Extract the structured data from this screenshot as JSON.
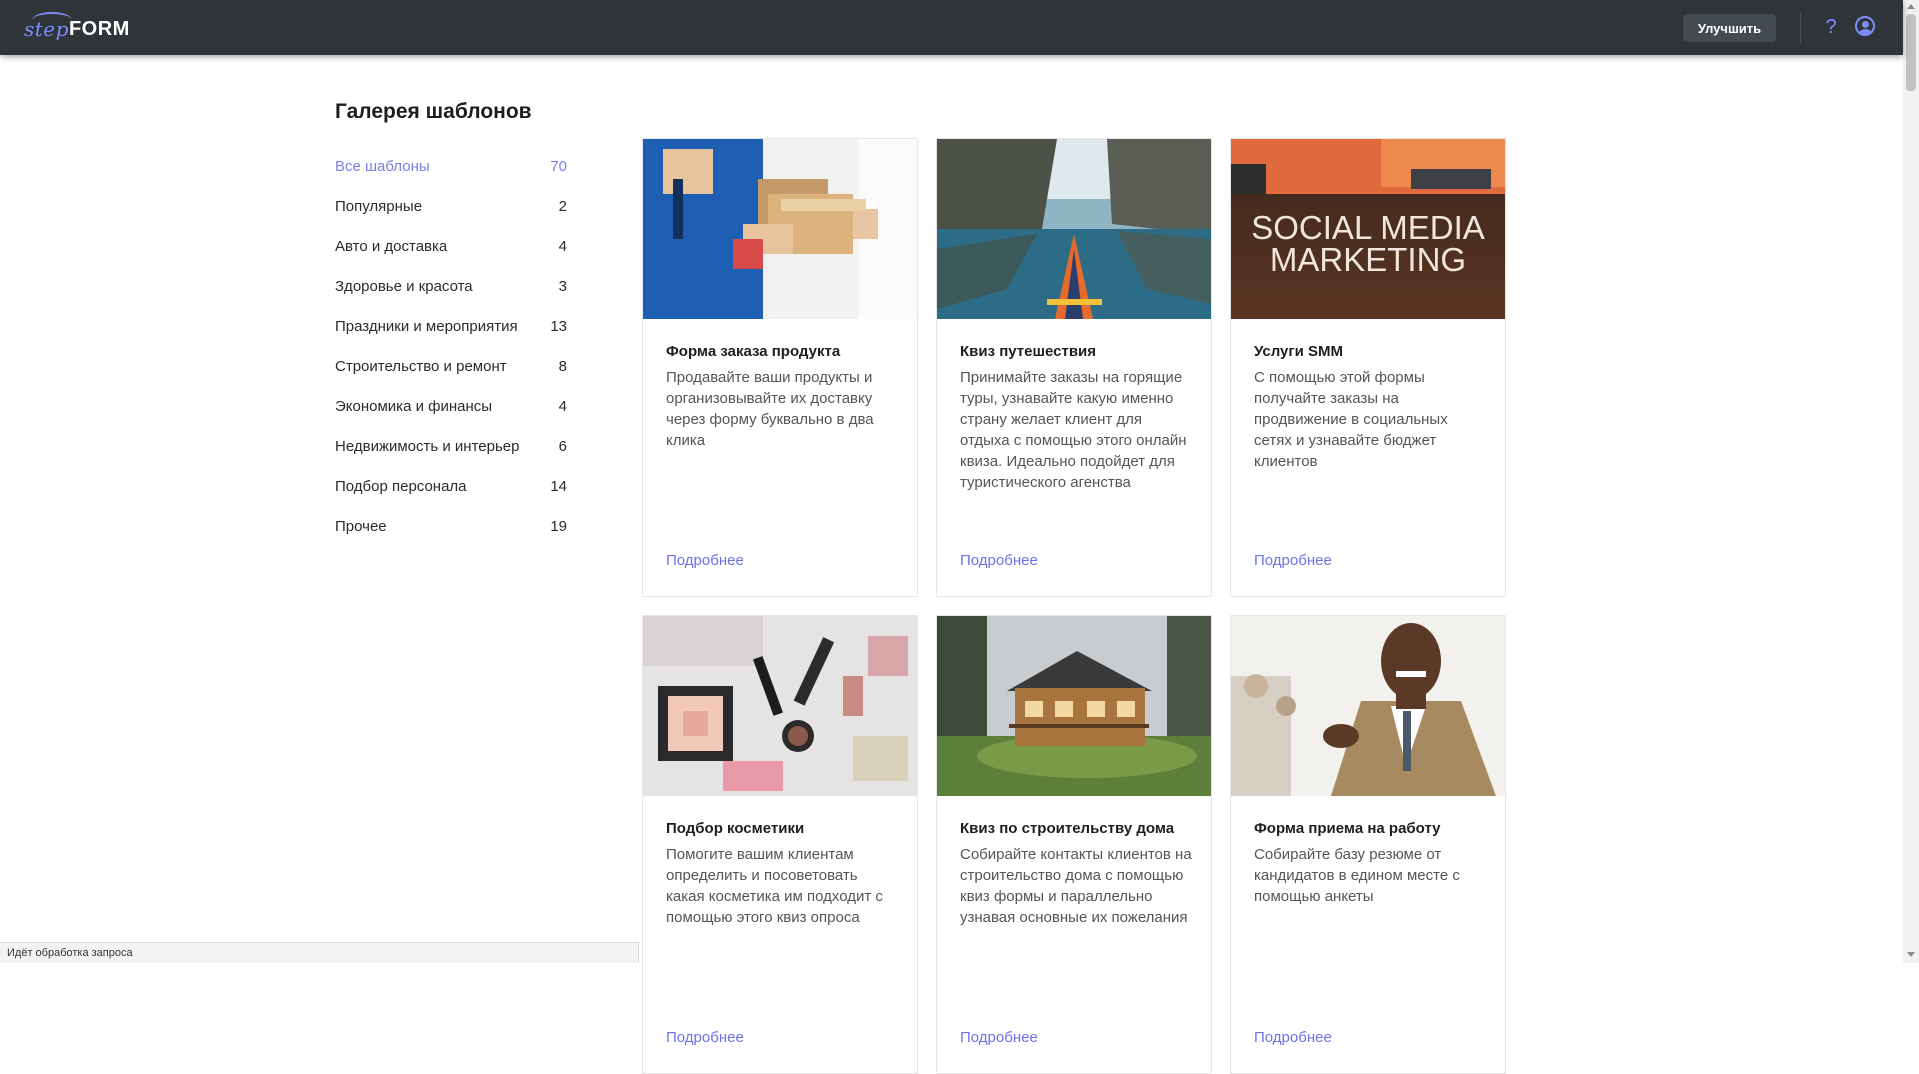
{
  "header": {
    "logo_step": "step",
    "logo_form": "FORM",
    "upgrade_label": "Улучшить",
    "help_label": "?"
  },
  "gallery": {
    "title": "Галерея шаблонов",
    "categories": [
      {
        "label": "Все шаблоны",
        "count": "70",
        "active": true
      },
      {
        "label": "Популярные",
        "count": "2"
      },
      {
        "label": "Авто и доставка",
        "count": "4"
      },
      {
        "label": "Здоровье и красота",
        "count": "3"
      },
      {
        "label": "Праздники и мероприятия",
        "count": "13"
      },
      {
        "label": "Строительство и ремонт",
        "count": "8"
      },
      {
        "label": "Экономика и финансы",
        "count": "4"
      },
      {
        "label": "Недвижимость и интерьер",
        "count": "6"
      },
      {
        "label": "Подбор персонала",
        "count": "14"
      },
      {
        "label": "Прочее",
        "count": "19"
      }
    ]
  },
  "cards": [
    {
      "title": "Форма заказа продукта",
      "description": "Продавайте ваши продукты и организовывайте их доставку через форму буквально в два клика",
      "link": "Подробнее",
      "image": "delivery-photo"
    },
    {
      "title": "Квиз путешествия",
      "description": "Принимайте заказы на горящие туры, узнавайте какую именно страну желает клиент для отдыха с помощью этого онлайн квиза. Идеально подойдет для туристического агенства",
      "link": "Подробнее",
      "image": "kayak-fjord-photo"
    },
    {
      "title": "Услуги SMM",
      "description": "С помощью этой формы получайте заказы на продвижение в социальных сетях и узнавайте бюджет клиентов",
      "link": "Подробнее",
      "image": "smm-photo",
      "image_text": "SOCIAL MEDIA MARKETING"
    },
    {
      "title": "Подбор косметики",
      "description": "Помогите вашим клиентам определить и посоветовать какая косметика им подходит с помощью этого квиз опроса",
      "link": "Подробнее",
      "image": "cosmetics-photo"
    },
    {
      "title": "Квиз по строительству дома",
      "description": "Собирайте контакты клиентов на строительство дома с помощью квиз формы и параллельно узнавая основные их пожелания",
      "link": "Подробнее",
      "image": "house-photo"
    },
    {
      "title": "Форма приема на работу",
      "description": "Собирайте базу резюме от кандидатов в едином месте с помощью анкеты",
      "link": "Подробнее",
      "image": "businessman-photo"
    }
  ],
  "status_bar": {
    "text": "Идёт обработка запроса"
  },
  "colors": {
    "header_bg": "#2e3438",
    "accent": "#7b7fe6",
    "link": "#6e72e8"
  }
}
